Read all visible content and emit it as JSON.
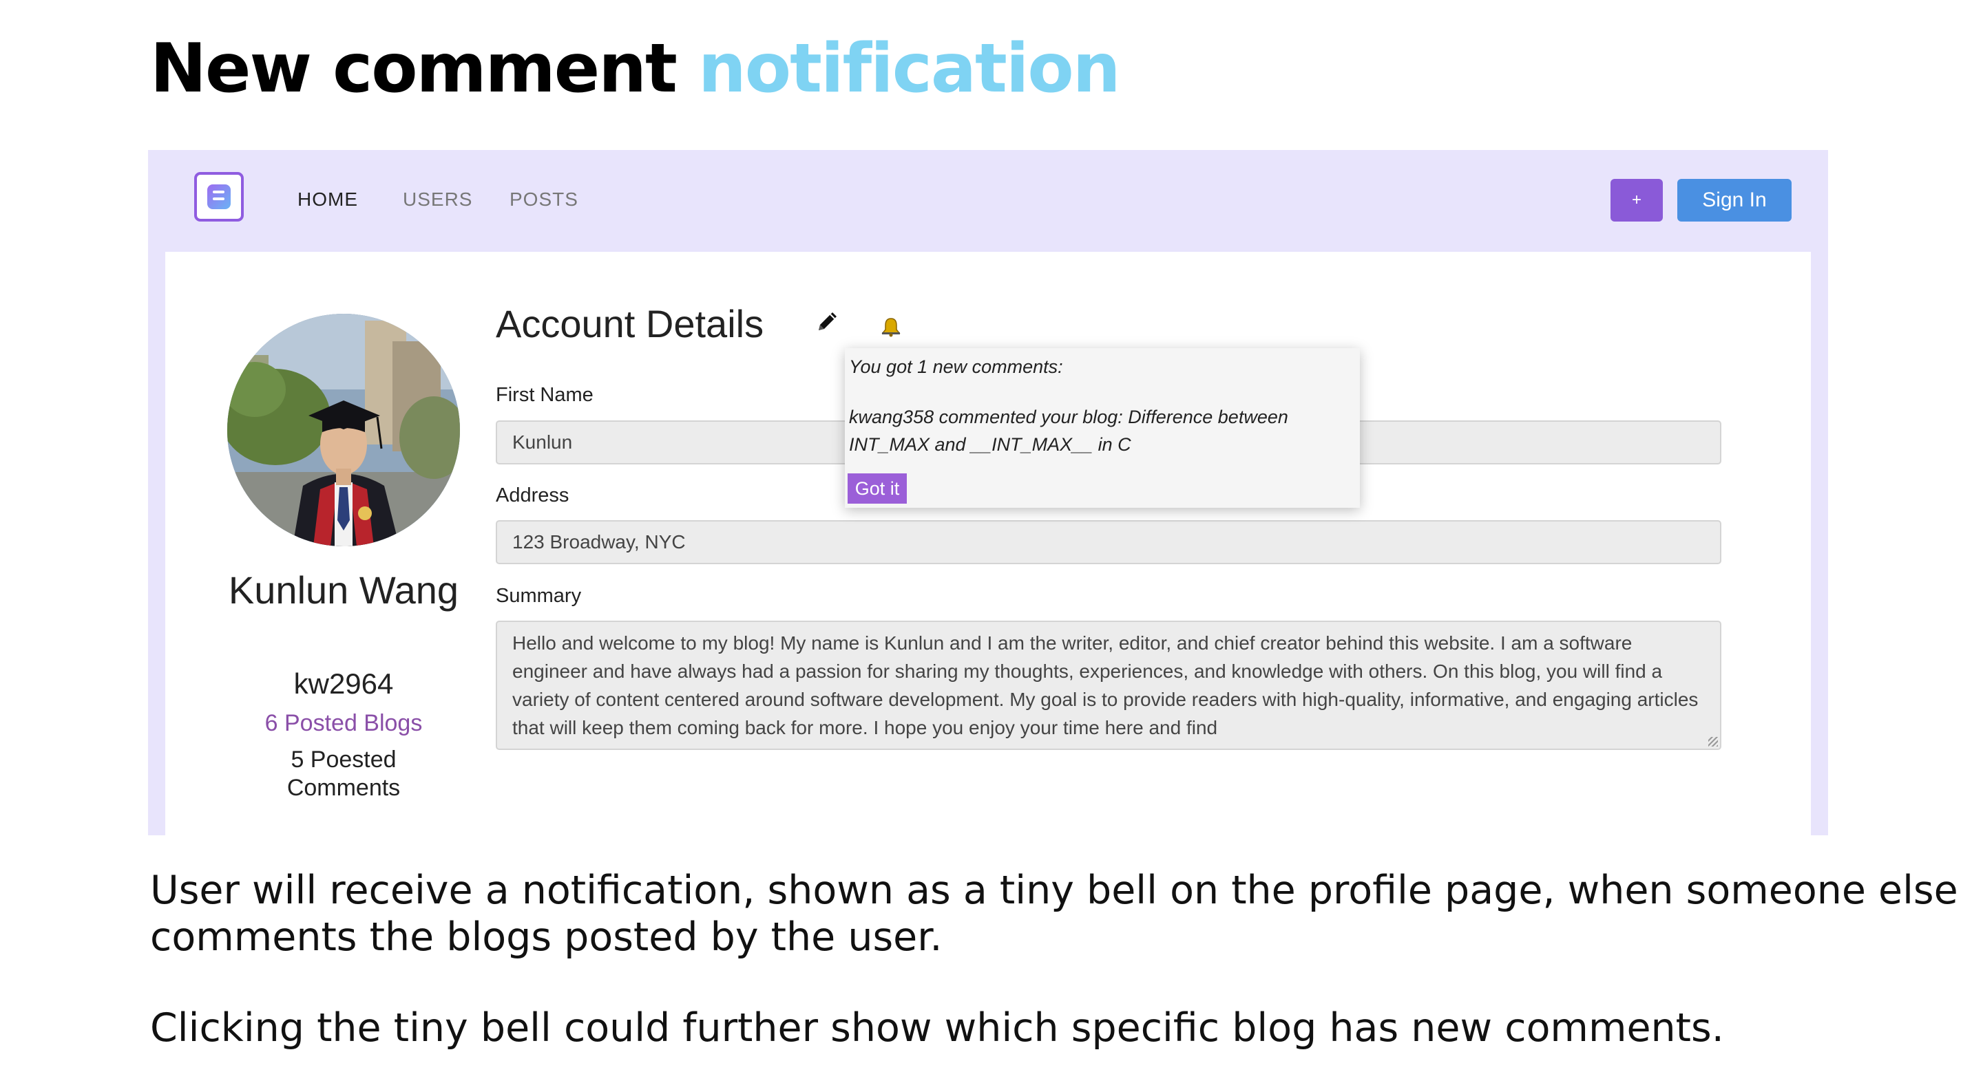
{
  "slide": {
    "title_part1": "New comment",
    "title_part2": "notification",
    "caption_1": "User will receive a notification, shown as a tiny bell on the profile page, when someone else comments the blogs posted by the user.",
    "caption_2": "Clicking the tiny bell could further show which specific blog has new comments."
  },
  "navbar": {
    "logo_icon": "blogger-logo-icon",
    "links": [
      "HOME",
      "USERS",
      "POSTS"
    ],
    "active_link": "HOME",
    "plus_label": "+",
    "signin_label": "Sign In"
  },
  "profile": {
    "name": "Kunlun Wang",
    "username": "kw2964",
    "posted_blogs": "6 Posted Blogs",
    "posted_comments": "5 Poested Comments"
  },
  "account": {
    "title": "Account Details",
    "edit_icon": "pencil-icon",
    "bell_icon": "bell-icon",
    "first_name_label": "First Name",
    "first_name_value": "Kunlun",
    "address_label": "Address",
    "address_value": "123 Broadway, NYC",
    "summary_label": "Summary",
    "summary_value": "Hello and welcome to my blog! My name is Kunlun  and I am the writer, editor, and chief creator behind this website. I am a software engineer and have always had a passion for sharing my thoughts, experiences, and knowledge with others. On this blog, you will find a variety of content centered around software development. My goal is to provide readers with high-quality, informative, and engaging articles that will keep them coming back for more. I hope you enjoy your time here and find"
  },
  "notification": {
    "header": "You got 1 new comments:",
    "message": "kwang358 commented your blog: Difference between INT_MAX and __INT_MAX__ in C",
    "button_label": "Got it"
  },
  "colors": {
    "title_accent": "#7fd3f3",
    "navbar_bg": "#e8e4fc",
    "plus_button": "#8a5ad8",
    "signin_button": "#4a90e2",
    "blogs_link": "#8a4fa8",
    "got_it_button": "#9b5fd8"
  }
}
